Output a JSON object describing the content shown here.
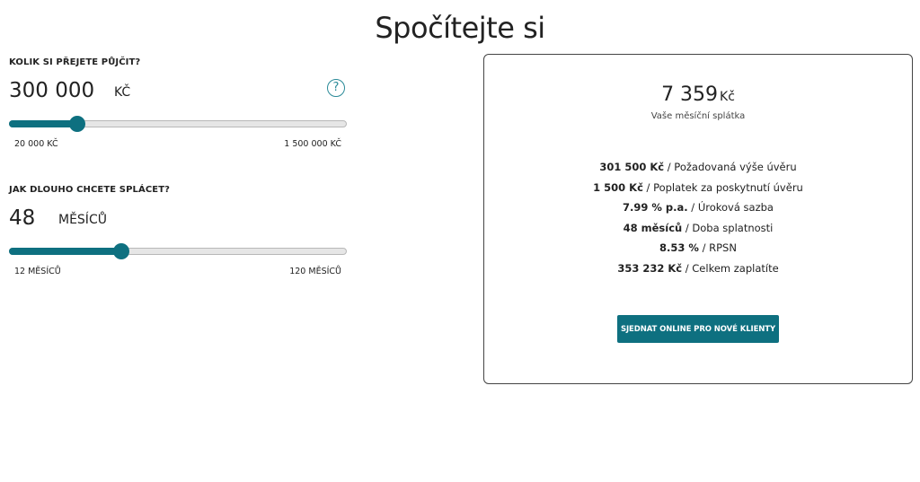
{
  "page": {
    "title": "Spočítejte si"
  },
  "loan_amount": {
    "label": "KOLIK SI PŘEJETE PŮJČIT?",
    "value": "300 000",
    "unit": "KČ",
    "help_icon_glyph": "?",
    "min_label": "20 000 KČ",
    "max_label": "1 500 000 KČ",
    "min": 20000,
    "max": 1500000,
    "current": 300000
  },
  "loan_term": {
    "label": "JAK DLOUHO CHCETE SPLÁCET?",
    "value": "48",
    "unit": "MĚSÍCŮ",
    "min_label": "12 MĚSÍCŮ",
    "max_label": "120 MĚSÍCŮ",
    "min": 12,
    "max": 120,
    "current": 48
  },
  "summary": {
    "monthly_amount": "7 359",
    "monthly_currency": "Kč",
    "monthly_caption": "Vaše měsíční splátka",
    "details": [
      {
        "value": "301 500 Kč",
        "label": " / Požadovaná výše úvěru"
      },
      {
        "value": "1 500 Kč",
        "label": " / Poplatek za poskytnutí úvěru"
      },
      {
        "value": "7.99 % p.a.",
        "label": " / Úroková sazba"
      },
      {
        "value": "48 měsíců",
        "label": " / Doba splatnosti"
      },
      {
        "value": "8.53 %",
        "label": " / RPSN"
      },
      {
        "value": "353 232 Kč",
        "label": " / Celkem zaplatíte"
      }
    ],
    "cta_label": "SJEDNAT ONLINE PRO NOVÉ KLIENTY"
  },
  "colors": {
    "accent": "#0e7080",
    "help_icon": "#2a8a98",
    "track": "#e6e6e6",
    "card_border": "#444444"
  }
}
